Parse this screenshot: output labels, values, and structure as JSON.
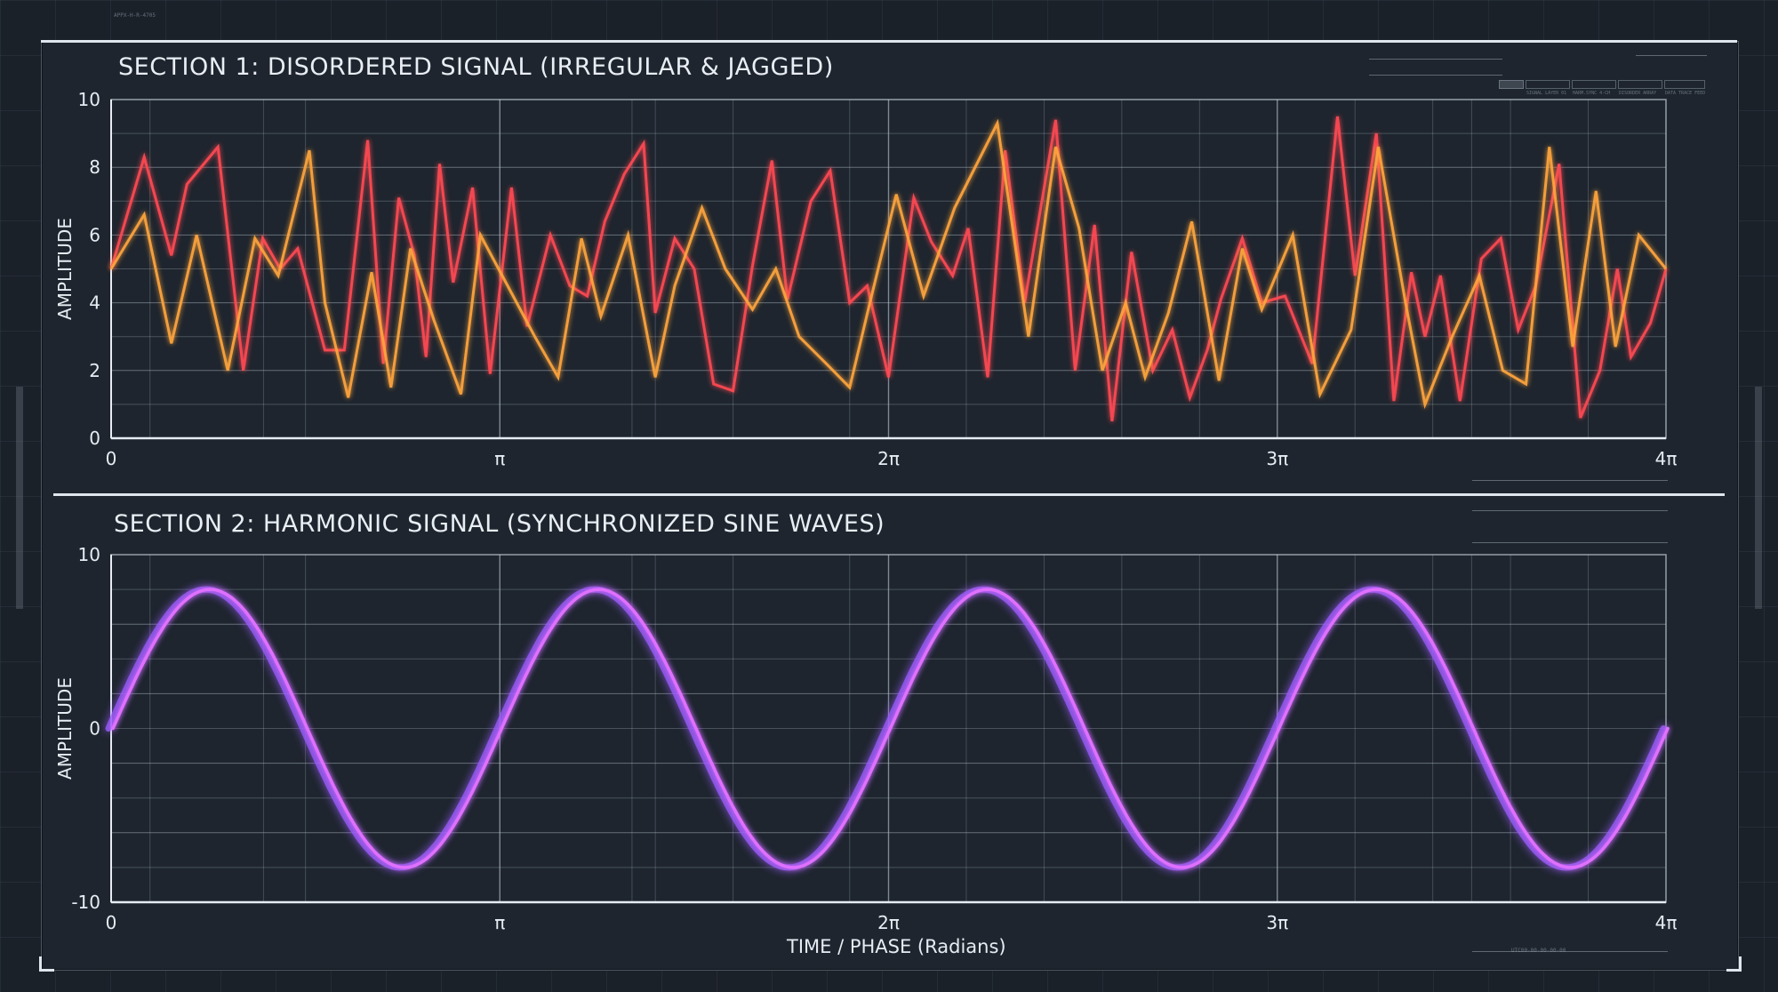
{
  "colors": {
    "background": "#1b2129",
    "grid": "#aeb8c4",
    "red_series": "#ff4a52",
    "orange_series": "#ffa53e",
    "purple_series": "#9a5cff",
    "magenta_series": "#e070ff"
  },
  "chart_data": [
    {
      "type": "line",
      "title": "SECTION 1: DISORDERED SIGNAL (IRREGULAR & JAGGED)",
      "ylabel": "AMPLITUDE",
      "xlabel": "",
      "xlim": [
        0,
        4
      ],
      "ylim": [
        0,
        10
      ],
      "x_unit": "π",
      "xticks": [
        "0",
        "π",
        "2π",
        "3π",
        "4π"
      ],
      "yticks": [
        "0",
        "2",
        "4",
        "6",
        "8",
        "10"
      ],
      "grid": true,
      "series": [
        {
          "color": "#ff4a52",
          "x": [
            0,
            0.085,
            0.155,
            0.195,
            0.275,
            0.34,
            0.39,
            0.435,
            0.48,
            0.55,
            0.6,
            0.66,
            0.7,
            0.74,
            0.78,
            0.81,
            0.845,
            0.88,
            0.93,
            0.975,
            1.03,
            1.07,
            1.13,
            1.18,
            1.225,
            1.27,
            1.32,
            1.37,
            1.4,
            1.45,
            1.5,
            1.55,
            1.6,
            1.65,
            1.7,
            1.74,
            1.8,
            1.85,
            1.9,
            1.945,
            2.0,
            2.065,
            2.11,
            2.165,
            2.205,
            2.255,
            2.3,
            2.35,
            2.43,
            2.48,
            2.53,
            2.575,
            2.625,
            2.68,
            2.73,
            2.775,
            2.82,
            2.855,
            2.91,
            2.96,
            3.02,
            3.09,
            3.155,
            3.2,
            3.255,
            3.3,
            3.345,
            3.38,
            3.42,
            3.47,
            3.525,
            3.575,
            3.62,
            3.665,
            3.725,
            3.78,
            3.83,
            3.875,
            3.91,
            3.96,
            4.0
          ],
          "y": [
            5,
            8.3,
            5.4,
            7.5,
            8.6,
            2.0,
            5.9,
            5.0,
            5.6,
            2.6,
            2.6,
            8.8,
            2.2,
            7.1,
            5.4,
            2.4,
            8.1,
            4.6,
            7.4,
            1.9,
            7.4,
            3.3,
            6.0,
            4.5,
            4.2,
            6.4,
            7.8,
            8.7,
            3.7,
            5.9,
            5.0,
            1.6,
            1.4,
            5.1,
            8.2,
            4.1,
            7.0,
            7.9,
            4.0,
            4.5,
            1.8,
            7.1,
            5.8,
            4.8,
            6.2,
            1.8,
            8.5,
            4.0,
            9.4,
            2.0,
            6.3,
            0.5,
            5.5,
            2.0,
            3.2,
            1.2,
            2.6,
            4.1,
            5.9,
            4.0,
            4.2,
            2.2,
            9.5,
            4.8,
            9.0,
            1.1,
            4.9,
            3.0,
            4.8,
            1.1,
            5.3,
            5.9,
            3.2,
            4.5,
            8.1,
            0.6,
            2.0,
            5.0,
            2.4,
            3.4,
            5.0
          ]
        },
        {
          "color": "#ffa53e",
          "x": [
            0,
            0.085,
            0.155,
            0.22,
            0.3,
            0.37,
            0.43,
            0.51,
            0.55,
            0.61,
            0.67,
            0.72,
            0.77,
            0.83,
            0.9,
            0.95,
            1.02,
            1.09,
            1.15,
            1.21,
            1.26,
            1.33,
            1.4,
            1.45,
            1.52,
            1.58,
            1.65,
            1.71,
            1.77,
            1.84,
            1.9,
            1.95,
            2.02,
            2.09,
            2.17,
            2.28,
            2.36,
            2.43,
            2.49,
            2.55,
            2.61,
            2.66,
            2.72,
            2.78,
            2.85,
            2.91,
            2.96,
            3.04,
            3.11,
            3.19,
            3.26,
            3.33,
            3.38,
            3.45,
            3.52,
            3.58,
            3.64,
            3.7,
            3.76,
            3.82,
            3.87,
            3.93,
            4.0
          ],
          "y": [
            5,
            6.6,
            2.8,
            6.0,
            2.0,
            5.9,
            4.8,
            8.5,
            4.0,
            1.2,
            4.9,
            1.5,
            5.6,
            3.5,
            1.3,
            6.0,
            4.5,
            3.0,
            1.8,
            5.9,
            3.6,
            6.0,
            1.8,
            4.5,
            6.8,
            5.0,
            3.8,
            5.0,
            3.0,
            2.2,
            1.5,
            3.9,
            7.2,
            4.2,
            6.8,
            9.3,
            3.0,
            8.6,
            6.2,
            2.0,
            4.0,
            1.8,
            3.7,
            6.4,
            1.7,
            5.6,
            3.8,
            6.0,
            1.3,
            3.2,
            8.6,
            4.0,
            1.0,
            3.0,
            4.8,
            2.0,
            1.6,
            8.6,
            2.7,
            7.3,
            2.7,
            6.0,
            5.0
          ]
        }
      ]
    },
    {
      "type": "line",
      "title": "SECTION 2: HARMONIC SIGNAL (SYNCHRONIZED SINE WAVES)",
      "ylabel": "AMPLITUDE",
      "xlabel": "TIME / PHASE (Radians)",
      "xlim": [
        0,
        4
      ],
      "ylim": [
        -10,
        10
      ],
      "x_unit": "π",
      "xticks": [
        "0",
        "π",
        "2π",
        "3π",
        "4π"
      ],
      "yticks": [
        "-10",
        "0",
        "10"
      ],
      "grid": true,
      "series": [
        {
          "color": "#9a5cff",
          "function": "8*sin(2*pi*x)",
          "amplitude": 8,
          "cycles": 4
        },
        {
          "color": "#e070ff",
          "function": "8*sin(2*pi*x)",
          "amplitude": 8,
          "cycles": 4
        }
      ]
    }
  ],
  "hud": {
    "top_left_code": "APPX-H-R-4705",
    "bottom_right_code": "UTC00-00-00-00-00",
    "panel_codes": [
      "SIGNAL LAYER 01",
      "HARM.SYNC 4-CH",
      "DISORDER ARRAY",
      "DATA TRACE FEED"
    ]
  }
}
